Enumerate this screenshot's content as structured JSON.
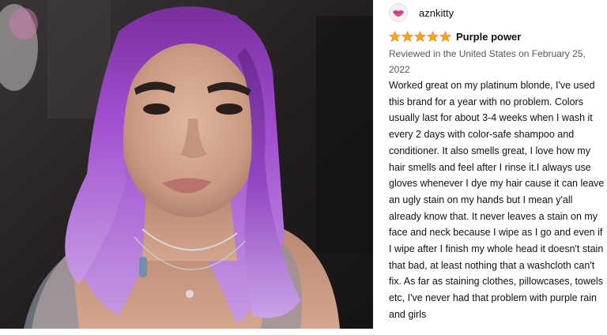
{
  "review": {
    "username": "aznkitty",
    "avatar_icon": "lips-icon",
    "rating": {
      "value": 5,
      "max": 5,
      "color": "#ffa41c"
    },
    "title": "Purple power",
    "meta": "Reviewed in the United States on February 25, 2022",
    "body": "Worked great on my platinum blonde, I've used this brand for a year with no problem. Colors usually last for about 3-4 weeks when I wash it every 2 days with color-safe shampoo and conditioner. It also smells great, I love how my hair smells and feel after I rinse it.I always use gloves whenever I dye my hair cause it can leave an ugly stain on my hands but I mean y'all already know that. It never leaves a stain on my face and neck because I wipe as I go and even if I wipe after I finish my whole head it doesn't stain that bad, at least nothing that a washcloth can't fix. As far as staining clothes, pillowcases, towels, etc, I've never had that problem with purple rain and girls"
  },
  "photo": {
    "subject": "customer-review-photo",
    "hair_color": "#9b4fc4"
  }
}
